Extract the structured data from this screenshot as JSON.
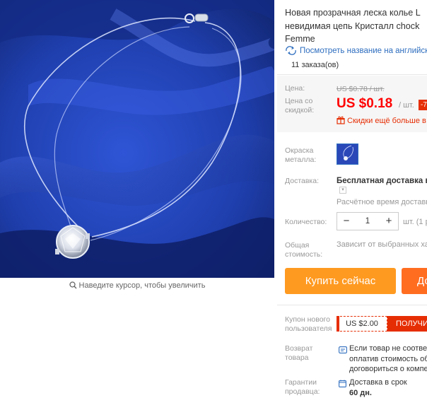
{
  "product": {
    "title": "Новая прозрачная леска колье L\nневидимая цепь Кристалл chock\nFemme",
    "translate_link": "Посмотреть название на английск",
    "orders": "11 заказа(ов)"
  },
  "gallery": {
    "zoom_hint": "Наведите курсор, чтобы увеличить"
  },
  "price": {
    "label": "Цена:",
    "old": "US $0.78 / шт.",
    "discount_label": "Цена со\nскидкой:",
    "new": "US $0.18",
    "unit": "/ шт.",
    "badge": "-7",
    "sale_text": "Скидки ещё больше в"
  },
  "color": {
    "label": "Окраска\nметалла:"
  },
  "shipping": {
    "label": "Доставка:",
    "value": "Бесплатная доставка в",
    "dropdown_icon": "chevron-down",
    "estimate": "Расчётное время доставк"
  },
  "quantity": {
    "label": "Количество:",
    "minus": "−",
    "value": "1",
    "plus": "+",
    "unit": "шт. (1 р"
  },
  "total": {
    "label": "Общая\nстоимость:",
    "value": "Зависит от выбранных ха"
  },
  "actions": {
    "buy_now": "Купить сейчас",
    "add_to_cart": "До"
  },
  "coupon": {
    "label": "Купон нового\nпользователя",
    "value": "US $2.00",
    "get": "ПОЛУЧИ"
  },
  "returns": {
    "label": "Возврат\nтовара",
    "text": "Если товар не соответ\nоплатив стоимость об\nдоговориться о компе"
  },
  "guarantee": {
    "label": "Гарантии\nпродавца:",
    "text": "Доставка в срок",
    "days": "60 дн."
  },
  "colors": {
    "accent_red": "#e62e04",
    "price_red": "#ff0000",
    "buy_orange": "#ff9a21",
    "cart_orange": "#ff6d21",
    "link_blue": "#2e6ebf",
    "fabric_blue": "#1f3fae"
  }
}
